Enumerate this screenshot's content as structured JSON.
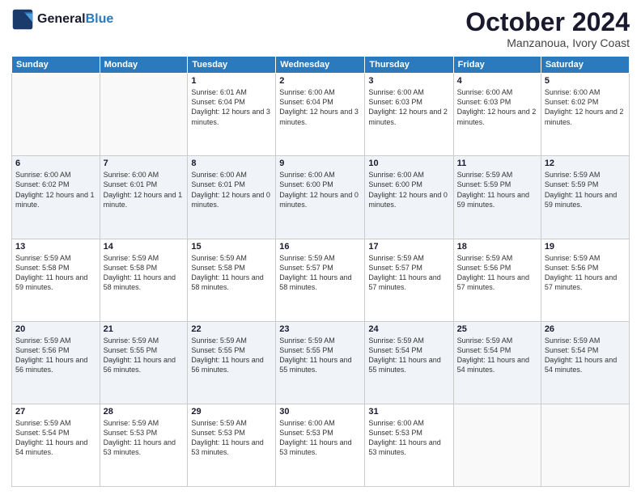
{
  "header": {
    "logo_line1": "General",
    "logo_line2": "Blue",
    "month": "October 2024",
    "location": "Manzanoua, Ivory Coast"
  },
  "weekdays": [
    "Sunday",
    "Monday",
    "Tuesday",
    "Wednesday",
    "Thursday",
    "Friday",
    "Saturday"
  ],
  "weeks": [
    [
      {
        "day": "",
        "info": ""
      },
      {
        "day": "",
        "info": ""
      },
      {
        "day": "1",
        "info": "Sunrise: 6:01 AM\nSunset: 6:04 PM\nDaylight: 12 hours and 3 minutes."
      },
      {
        "day": "2",
        "info": "Sunrise: 6:00 AM\nSunset: 6:04 PM\nDaylight: 12 hours and 3 minutes."
      },
      {
        "day": "3",
        "info": "Sunrise: 6:00 AM\nSunset: 6:03 PM\nDaylight: 12 hours and 2 minutes."
      },
      {
        "day": "4",
        "info": "Sunrise: 6:00 AM\nSunset: 6:03 PM\nDaylight: 12 hours and 2 minutes."
      },
      {
        "day": "5",
        "info": "Sunrise: 6:00 AM\nSunset: 6:02 PM\nDaylight: 12 hours and 2 minutes."
      }
    ],
    [
      {
        "day": "6",
        "info": "Sunrise: 6:00 AM\nSunset: 6:02 PM\nDaylight: 12 hours and 1 minute."
      },
      {
        "day": "7",
        "info": "Sunrise: 6:00 AM\nSunset: 6:01 PM\nDaylight: 12 hours and 1 minute."
      },
      {
        "day": "8",
        "info": "Sunrise: 6:00 AM\nSunset: 6:01 PM\nDaylight: 12 hours and 0 minutes."
      },
      {
        "day": "9",
        "info": "Sunrise: 6:00 AM\nSunset: 6:00 PM\nDaylight: 12 hours and 0 minutes."
      },
      {
        "day": "10",
        "info": "Sunrise: 6:00 AM\nSunset: 6:00 PM\nDaylight: 12 hours and 0 minutes."
      },
      {
        "day": "11",
        "info": "Sunrise: 5:59 AM\nSunset: 5:59 PM\nDaylight: 11 hours and 59 minutes."
      },
      {
        "day": "12",
        "info": "Sunrise: 5:59 AM\nSunset: 5:59 PM\nDaylight: 11 hours and 59 minutes."
      }
    ],
    [
      {
        "day": "13",
        "info": "Sunrise: 5:59 AM\nSunset: 5:58 PM\nDaylight: 11 hours and 59 minutes."
      },
      {
        "day": "14",
        "info": "Sunrise: 5:59 AM\nSunset: 5:58 PM\nDaylight: 11 hours and 58 minutes."
      },
      {
        "day": "15",
        "info": "Sunrise: 5:59 AM\nSunset: 5:58 PM\nDaylight: 11 hours and 58 minutes."
      },
      {
        "day": "16",
        "info": "Sunrise: 5:59 AM\nSunset: 5:57 PM\nDaylight: 11 hours and 58 minutes."
      },
      {
        "day": "17",
        "info": "Sunrise: 5:59 AM\nSunset: 5:57 PM\nDaylight: 11 hours and 57 minutes."
      },
      {
        "day": "18",
        "info": "Sunrise: 5:59 AM\nSunset: 5:56 PM\nDaylight: 11 hours and 57 minutes."
      },
      {
        "day": "19",
        "info": "Sunrise: 5:59 AM\nSunset: 5:56 PM\nDaylight: 11 hours and 57 minutes."
      }
    ],
    [
      {
        "day": "20",
        "info": "Sunrise: 5:59 AM\nSunset: 5:56 PM\nDaylight: 11 hours and 56 minutes."
      },
      {
        "day": "21",
        "info": "Sunrise: 5:59 AM\nSunset: 5:55 PM\nDaylight: 11 hours and 56 minutes."
      },
      {
        "day": "22",
        "info": "Sunrise: 5:59 AM\nSunset: 5:55 PM\nDaylight: 11 hours and 56 minutes."
      },
      {
        "day": "23",
        "info": "Sunrise: 5:59 AM\nSunset: 5:55 PM\nDaylight: 11 hours and 55 minutes."
      },
      {
        "day": "24",
        "info": "Sunrise: 5:59 AM\nSunset: 5:54 PM\nDaylight: 11 hours and 55 minutes."
      },
      {
        "day": "25",
        "info": "Sunrise: 5:59 AM\nSunset: 5:54 PM\nDaylight: 11 hours and 54 minutes."
      },
      {
        "day": "26",
        "info": "Sunrise: 5:59 AM\nSunset: 5:54 PM\nDaylight: 11 hours and 54 minutes."
      }
    ],
    [
      {
        "day": "27",
        "info": "Sunrise: 5:59 AM\nSunset: 5:54 PM\nDaylight: 11 hours and 54 minutes."
      },
      {
        "day": "28",
        "info": "Sunrise: 5:59 AM\nSunset: 5:53 PM\nDaylight: 11 hours and 53 minutes."
      },
      {
        "day": "29",
        "info": "Sunrise: 5:59 AM\nSunset: 5:53 PM\nDaylight: 11 hours and 53 minutes."
      },
      {
        "day": "30",
        "info": "Sunrise: 6:00 AM\nSunset: 5:53 PM\nDaylight: 11 hours and 53 minutes."
      },
      {
        "day": "31",
        "info": "Sunrise: 6:00 AM\nSunset: 5:53 PM\nDaylight: 11 hours and 53 minutes."
      },
      {
        "day": "",
        "info": ""
      },
      {
        "day": "",
        "info": ""
      }
    ]
  ]
}
